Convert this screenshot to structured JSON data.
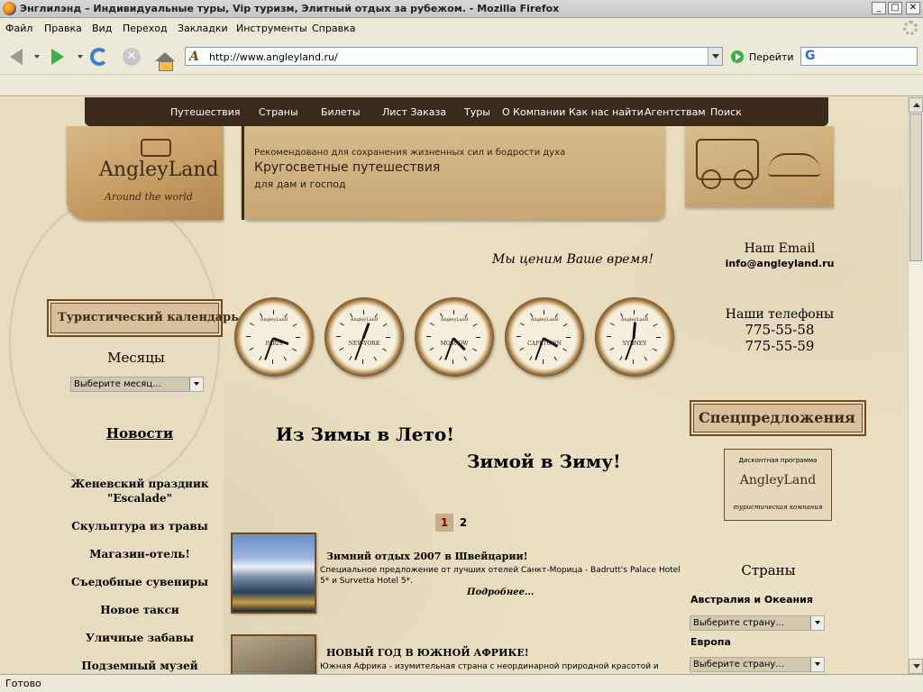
{
  "window": {
    "title": "Энглилэнд – Индивидуальные туры, Vip туризм, Элитный отдых за рубежом. - Mozilla Firefox",
    "min": "_",
    "max": "□",
    "close": "✕"
  },
  "menu": [
    "Файл",
    "Правка",
    "Вид",
    "Переход",
    "Закладки",
    "Инструменты",
    "Справка"
  ],
  "nav": {
    "url": "http://www.angleyland.ru/",
    "go_label": "Перейти",
    "search_logo": "G"
  },
  "status": "Готово",
  "site": {
    "topnav": [
      "Путешествия",
      "Страны",
      "Билеты",
      "Лист Заказа",
      "Туры",
      "О Компании",
      "Как нас найти",
      "Агентствам",
      "Поиск"
    ],
    "logo": {
      "name": "AngleyLand",
      "sub": "Around the world"
    },
    "banner": {
      "line1": "Рекомендовано для сохранения жизненных сил и бодрости духа",
      "line2": "Кругосветные путешествия",
      "line3": "для дам и господ"
    },
    "slogan": "Мы ценим Ваше время!",
    "contacts": {
      "email_title": "Наш Email",
      "email": "info@angleyland.ru",
      "phones_title": "Наши телефоны",
      "phone1": "775-55-58",
      "phone2": "775-55-59"
    },
    "clocks": [
      {
        "city": "PARIS",
        "hour_deg": 20,
        "min_deg": 110
      },
      {
        "city": "NEW-YORK",
        "hour_deg": -70,
        "min_deg": 110
      },
      {
        "city": "MOSCOW",
        "hour_deg": 45,
        "min_deg": 110
      },
      {
        "city": "CAPETOWN",
        "hour_deg": 30,
        "min_deg": 110
      },
      {
        "city": "SYDNEY",
        "hour_deg": -85,
        "min_deg": 110
      }
    ],
    "clock_brand": "AngleyLand",
    "calendar": {
      "button": "Туристический календарь",
      "months_title": "Месяцы",
      "month_select": "Выберите месяц..."
    },
    "news": {
      "title": "Новости",
      "items": [
        "Женевский праздник \"Escalade\"",
        "Скульптура из травы",
        "Магазин-отель!",
        "Съедобные сувениры",
        "Новое такси",
        "Уличные забавы",
        "Подземный музей"
      ]
    },
    "headlines": {
      "h1": "Из Зимы в Лето!",
      "h2": "Зимой в Зиму!"
    },
    "pager": [
      "1",
      "2"
    ],
    "offers": [
      {
        "title": "Зимний отдых 2007 в Швейцарии!",
        "desc": "Специальное предложение от лучших отелей Санкт-Морица - Badrutt's Palace Hotel 5* и Survetta Hotel 5*.",
        "more": "Подробнее..."
      },
      {
        "title": "НОВЫЙ ГОД В ЮЖНОЙ АФРИКЕ!",
        "desc": "Южная Африка - изумительная страна с неординарной природной красотой и",
        "more": ""
      }
    ],
    "special": {
      "title": "Спецпредложения",
      "discount_top": "Дисконтная программа",
      "discount_name": "AngleyLand",
      "discount_sub": "туристическая компания"
    },
    "countries": {
      "title": "Страны",
      "regions": [
        {
          "name": "Австралия и Океания",
          "select": "Выберите страну..."
        },
        {
          "name": "Европа",
          "select": "Выберите страну..."
        }
      ]
    }
  }
}
